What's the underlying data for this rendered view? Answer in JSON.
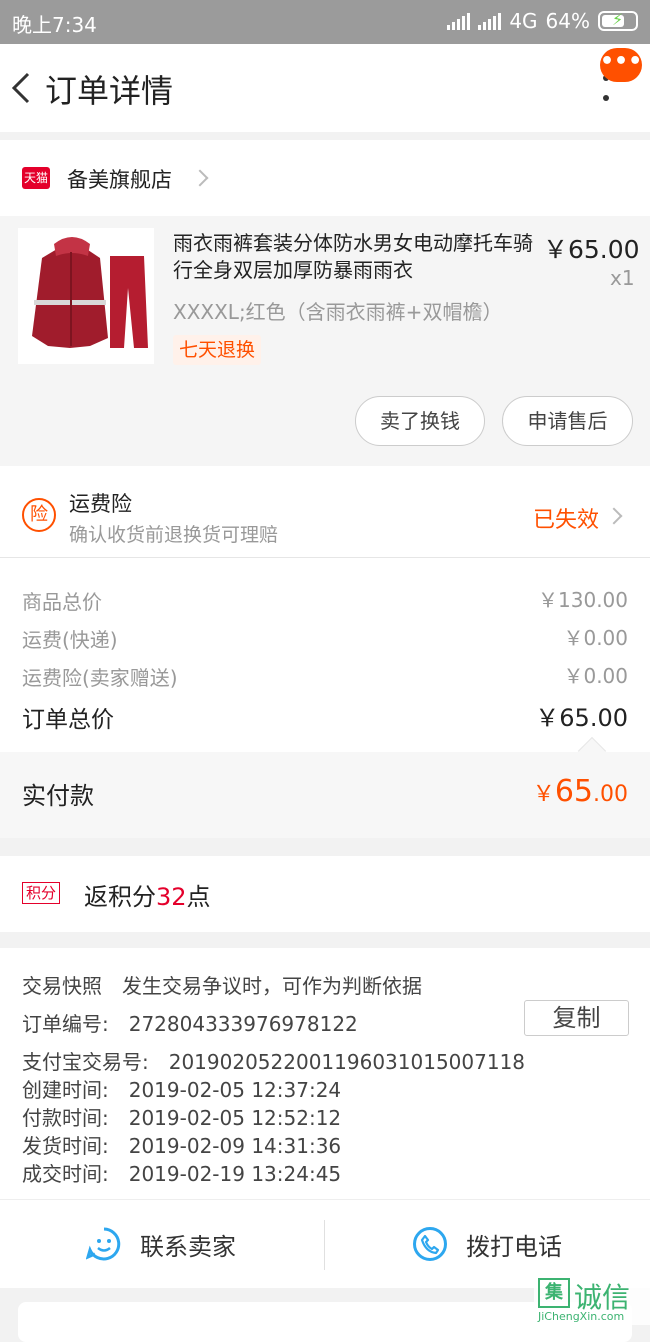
{
  "status_bar": {
    "time": "晚上7:34",
    "network": "4G",
    "battery": "64%"
  },
  "header": {
    "title": "订单详情",
    "more_badge": "•••"
  },
  "shop": {
    "badge": "天猫",
    "name": "备美旗舰店"
  },
  "product": {
    "title": "雨衣雨裤套装分体防水男女电动摩托车骑行全身双层加厚防暴雨雨衣",
    "price": "￥65.00",
    "qty": "x1",
    "sku": "XXXXL;红色（含雨衣雨裤+双帽檐）",
    "tag": "七天退换",
    "btn_sell": "卖了换钱",
    "btn_after_sale": "申请售后"
  },
  "insurance": {
    "icon": "险",
    "title": "运费险",
    "desc": "确认收货前退换货可理赔",
    "status": "已失效"
  },
  "prices": {
    "goods_label": "商品总价",
    "goods_value": "￥130.00",
    "shipping_label": "运费(快递)",
    "shipping_value": "￥0.00",
    "ins_label": "运费险(卖家赠送)",
    "ins_value": "￥0.00",
    "total_label": "订单总价",
    "total_value": "￥65.00"
  },
  "paid": {
    "label": "实付款",
    "currency": "￥",
    "integer": "65",
    "decimal": ".00"
  },
  "points": {
    "tag": "积分",
    "prefix": "返积分",
    "num": "32",
    "suffix": "点"
  },
  "order_info": {
    "snapshot": "交易快照　发生交易争议时，可作为判断依据",
    "order_no": "订单编号:　272804333976978122",
    "copy_btn": "复制",
    "alipay_no": "支付宝交易号:　2019020522001196031015007118",
    "created": "创建时间:　2019-02-05 12:37:24",
    "paid_time": "付款时间:　2019-02-05 12:52:12",
    "shipped": "发货时间:　2019-02-09 14:31:36",
    "completed": "成交时间:　2019-02-19 13:24:45"
  },
  "contact": {
    "seller": "联系卖家",
    "phone": "拨打电话"
  },
  "watermark": {
    "logo": "集",
    "text": "诚信",
    "sub": "JiChengXin.com"
  },
  "colors": {
    "accent": "#ff5000",
    "tmall": "#e4002b",
    "contact_icon": "#2da7ef"
  }
}
